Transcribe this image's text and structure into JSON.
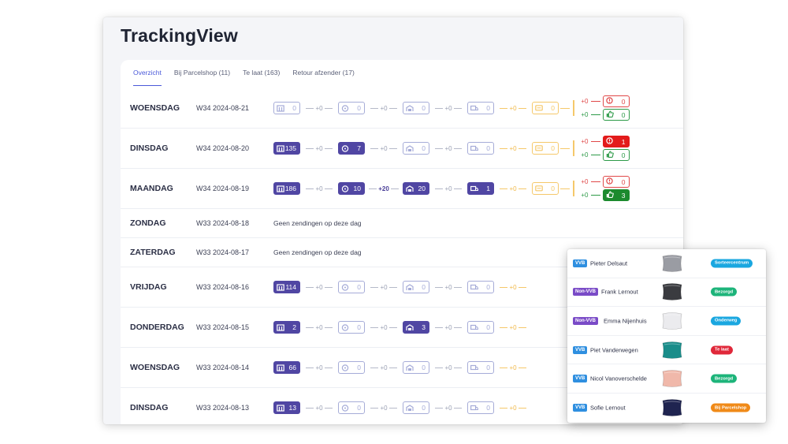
{
  "app": {
    "title": "TrackingView"
  },
  "tabs": [
    {
      "label": "Overzicht",
      "active": true
    },
    {
      "label": "Bij Parcelshop (11)",
      "active": false
    },
    {
      "label": "Te laat (163)",
      "active": false
    },
    {
      "label": "Retour afzender (17)",
      "active": false
    }
  ],
  "no_shipments_text": "Geen zendingen op deze dag",
  "stage_icons": [
    "package-icon",
    "clock-icon",
    "warehouse-icon",
    "truck-icon",
    "message-icon"
  ],
  "rows": [
    {
      "day": "WOENSDAG",
      "week": "W34 2024-08-21",
      "stages": [
        "0",
        "0",
        "0",
        "0",
        "0"
      ],
      "deltas": [
        "+0",
        "+0",
        "+0",
        "+0"
      ],
      "tail_delta": "+0",
      "outcomes": {
        "late_delta": "+0",
        "late": "0",
        "ok_delta": "+0",
        "ok": "0"
      }
    },
    {
      "day": "DINSDAG",
      "week": "W34 2024-08-20",
      "stages": [
        "135",
        "7",
        "0",
        "0",
        "0"
      ],
      "deltas": [
        "+0",
        "+0",
        "+0",
        "+0"
      ],
      "tail_delta": "+0",
      "outcomes": {
        "late_delta": "+0",
        "late": "1",
        "ok_delta": "+0",
        "ok": "0"
      }
    },
    {
      "day": "MAANDAG",
      "week": "W34 2024-08-19",
      "stages": [
        "186",
        "10",
        "20",
        "1",
        "0"
      ],
      "deltas": [
        "+0",
        "+20",
        "+0",
        "+0"
      ],
      "tail_delta": "+0",
      "outcomes": {
        "late_delta": "+0",
        "late": "0",
        "ok_delta": "+0",
        "ok": "3"
      }
    },
    {
      "day": "ZONDAG",
      "week": "W33 2024-08-18",
      "empty": true
    },
    {
      "day": "ZATERDAG",
      "week": "W33 2024-08-17",
      "empty": true
    },
    {
      "day": "VRIJDAG",
      "week": "W33 2024-08-16",
      "stages": [
        "114",
        "0",
        "0",
        "0"
      ],
      "deltas": [
        "+0",
        "+0",
        "+0",
        "+0"
      ],
      "tail_delta": "+0"
    },
    {
      "day": "DONDERDAG",
      "week": "W33 2024-08-15",
      "stages": [
        "2",
        "0",
        "3",
        "0"
      ],
      "deltas": [
        "+0",
        "+0",
        "+0",
        "+0"
      ],
      "tail_delta": "+0"
    },
    {
      "day": "WOENSDAG",
      "week": "W33 2024-08-14",
      "stages": [
        "66",
        "0",
        "0",
        "0"
      ],
      "deltas": [
        "+0",
        "+0",
        "+0",
        "+0"
      ],
      "tail_delta": "+0"
    },
    {
      "day": "DINSDAG",
      "week": "W33 2024-08-13",
      "stages": [
        "13",
        "0",
        "0",
        "0"
      ],
      "deltas": [
        "+0",
        "+0",
        "+0",
        "+0"
      ],
      "tail_delta": "+0"
    }
  ],
  "overlay": {
    "customers": [
      {
        "tag": "VVB",
        "tag_color": "#2f8fe0",
        "name": "Pieter Delsaut",
        "product_color": "#9a9ca3",
        "status": "Sorteercentrum",
        "status_color": "#1aa7e0"
      },
      {
        "tag": "Non-VVB",
        "tag_color": "#7a4bc7",
        "name": "Frank Lernout",
        "product_color": "#3a3b40",
        "status": "Bezorgd",
        "status_color": "#1db47a"
      },
      {
        "tag": "Non-VVB",
        "tag_color": "#7a4bc7",
        "name": "Emma Nijenhuis",
        "product_color": "#ebebee",
        "status": "Onderweg",
        "status_color": "#1aa7e0"
      },
      {
        "tag": "VVB",
        "tag_color": "#2f8fe0",
        "name": "Piet Vanderwegen",
        "product_color": "#1a8d8a",
        "status": "Te laat",
        "status_color": "#e0283a"
      },
      {
        "tag": "VVB",
        "tag_color": "#2f8fe0",
        "name": "Nicol Vanoverschelde",
        "product_color": "#f0b8aa",
        "status": "Bezorgd",
        "status_color": "#1db47a"
      },
      {
        "tag": "VVB",
        "tag_color": "#2f8fe0",
        "name": "Sofie Lernout",
        "product_color": "#1f2450",
        "status": "Bij Parcelshop",
        "status_color": "#f08a18"
      }
    ]
  }
}
